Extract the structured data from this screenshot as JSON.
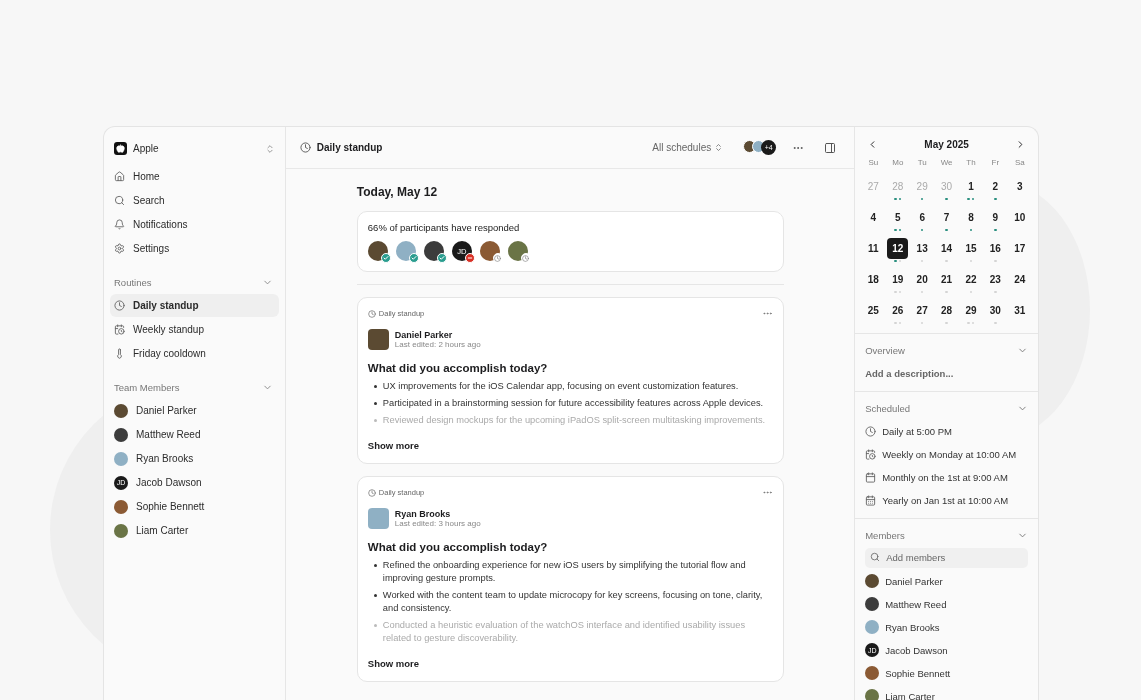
{
  "sidebar": {
    "workspace": "Apple",
    "nav": [
      {
        "label": "Home"
      },
      {
        "label": "Search"
      },
      {
        "label": "Notifications"
      },
      {
        "label": "Settings"
      }
    ],
    "routines": {
      "title": "Routines",
      "expanded": true,
      "items": [
        {
          "label": "Daily standup",
          "selected": true
        },
        {
          "label": "Weekly standup",
          "selected": false
        },
        {
          "label": "Friday cooldown",
          "selected": false
        }
      ]
    },
    "team": {
      "title": "Team Members",
      "expanded": true,
      "members": [
        {
          "name": "Daniel Parker",
          "kind": "photo"
        },
        {
          "name": "Matthew Reed",
          "kind": "photo"
        },
        {
          "name": "Ryan Brooks",
          "kind": "photo"
        },
        {
          "name": "Jacob Dawson",
          "kind": "initials",
          "initials": "JD"
        },
        {
          "name": "Sophie Bennett",
          "kind": "photo"
        },
        {
          "name": "Liam Carter",
          "kind": "photo"
        }
      ]
    }
  },
  "header": {
    "title": "Daily standup",
    "filter": "All schedules",
    "extra_count": "+4"
  },
  "feed": {
    "date": "Today, May 12",
    "responses": {
      "title": "66% of participants have responded",
      "participants": [
        {
          "kind": "photo",
          "responded": true,
          "declined": false
        },
        {
          "kind": "photo",
          "responded": true,
          "declined": false
        },
        {
          "kind": "photo",
          "responded": true,
          "declined": false
        },
        {
          "kind": "initials",
          "initials": "JD",
          "responded": false,
          "declined": true
        },
        {
          "kind": "photo",
          "responded": false,
          "declined": false
        },
        {
          "kind": "photo",
          "responded": false,
          "declined": false
        }
      ]
    },
    "entries": [
      {
        "tag": "Daily standup",
        "author": "Daniel Parker",
        "edited": "Last edited: 2 hours ago",
        "question": "What did you accomplish today?",
        "more": "Show more",
        "bullets": [
          {
            "text": "UX improvements for the iOS Calendar app, focusing on event customization features.",
            "faded": false
          },
          {
            "text": "Participated in a brainstorming session for future accessibility features across Apple devices.",
            "faded": false
          },
          {
            "text": "Reviewed design mockups for the upcoming iPadOS split-screen multitasking improvements.",
            "faded": true
          }
        ]
      },
      {
        "tag": "Daily standup",
        "author": "Ryan Brooks",
        "edited": "Last edited: 3 hours ago",
        "question": "What did you accomplish today?",
        "more": "Show more",
        "bullets": [
          {
            "text": "Refined the onboarding experience for new iOS users by simplifying the tutorial flow and improving gesture prompts.",
            "faded": false
          },
          {
            "text": "Worked with the content team to update microcopy for key screens, focusing on tone, clarity, and consistency.",
            "faded": false
          },
          {
            "text": "Conducted a heuristic evaluation of the watchOS interface and identified usability issues related to gesture discoverability.",
            "faded": true
          }
        ]
      }
    ]
  },
  "calendar": {
    "month": "May 2025",
    "weekdays": [
      "Su",
      "Mo",
      "Tu",
      "We",
      "Th",
      "Fr",
      "Sa"
    ],
    "weeks": [
      [
        {
          "label": "27",
          "muted": true,
          "selected": false
        },
        {
          "label": "28",
          "muted": true,
          "selected": false,
          "events": [
            {
              "done": true
            },
            {
              "done": true
            }
          ]
        },
        {
          "label": "29",
          "muted": true,
          "selected": false,
          "events": [
            {
              "done": true
            }
          ]
        },
        {
          "label": "30",
          "muted": true,
          "selected": false,
          "events": [
            {
              "done": true
            }
          ]
        },
        {
          "label": "1",
          "muted": false,
          "selected": false,
          "events": [
            {
              "done": true
            },
            {
              "done": true
            }
          ]
        },
        {
          "label": "2",
          "muted": false,
          "selected": false,
          "events": [
            {
              "done": true
            }
          ]
        },
        {
          "label": "3",
          "muted": false,
          "selected": false
        }
      ],
      [
        {
          "label": "4",
          "muted": false,
          "selected": false
        },
        {
          "label": "5",
          "muted": false,
          "selected": false,
          "events": [
            {
              "done": true
            },
            {
              "done": true
            }
          ]
        },
        {
          "label": "6",
          "muted": false,
          "selected": false,
          "events": [
            {
              "done": true
            }
          ]
        },
        {
          "label": "7",
          "muted": false,
          "selected": false,
          "events": [
            {
              "done": true
            }
          ]
        },
        {
          "label": "8",
          "muted": false,
          "selected": false,
          "events": [
            {
              "done": true
            }
          ]
        },
        {
          "label": "9",
          "muted": false,
          "selected": false,
          "events": [
            {
              "done": true
            }
          ]
        },
        {
          "label": "10",
          "muted": false,
          "selected": false
        }
      ],
      [
        {
          "label": "11",
          "muted": false,
          "selected": false
        },
        {
          "label": "12",
          "muted": false,
          "selected": true,
          "events": [
            {
              "done": true
            },
            {
              "done": false
            }
          ]
        },
        {
          "label": "13",
          "muted": false,
          "selected": false,
          "events": [
            {
              "done": false
            }
          ]
        },
        {
          "label": "14",
          "muted": false,
          "selected": false,
          "events": [
            {
              "done": false
            }
          ]
        },
        {
          "label": "15",
          "muted": false,
          "selected": false,
          "events": [
            {
              "done": false
            }
          ]
        },
        {
          "label": "16",
          "muted": false,
          "selected": false,
          "events": [
            {
              "done": false
            }
          ]
        },
        {
          "label": "17",
          "muted": false,
          "selected": false
        }
      ],
      [
        {
          "label": "18",
          "muted": false,
          "selected": false
        },
        {
          "label": "19",
          "muted": false,
          "selected": false,
          "events": [
            {
              "done": false
            },
            {
              "done": false
            }
          ]
        },
        {
          "label": "20",
          "muted": false,
          "selected": false,
          "events": [
            {
              "done": false
            }
          ]
        },
        {
          "label": "21",
          "muted": false,
          "selected": false,
          "events": [
            {
              "done": false
            }
          ]
        },
        {
          "label": "22",
          "muted": false,
          "selected": false,
          "events": [
            {
              "done": false
            }
          ]
        },
        {
          "label": "23",
          "muted": false,
          "selected": false,
          "events": [
            {
              "done": false
            }
          ]
        },
        {
          "label": "24",
          "muted": false,
          "selected": false
        }
      ],
      [
        {
          "label": "25",
          "muted": false,
          "selected": false
        },
        {
          "label": "26",
          "muted": false,
          "selected": false,
          "events": [
            {
              "done": false
            },
            {
              "done": false
            }
          ]
        },
        {
          "label": "27",
          "muted": false,
          "selected": false,
          "events": [
            {
              "done": false
            }
          ]
        },
        {
          "label": "28",
          "muted": false,
          "selected": false,
          "events": [
            {
              "done": false
            }
          ]
        },
        {
          "label": "29",
          "muted": false,
          "selected": false,
          "events": [
            {
              "done": false
            },
            {
              "done": false
            }
          ]
        },
        {
          "label": "30",
          "muted": false,
          "selected": false,
          "events": [
            {
              "done": false
            }
          ]
        },
        {
          "label": "31",
          "muted": false,
          "selected": false
        }
      ]
    ]
  },
  "details": {
    "overview": {
      "title": "Overview",
      "expanded": true,
      "placeholder": "Add a description..."
    },
    "scheduled": {
      "title": "Scheduled",
      "expanded": true,
      "items": [
        "Daily at 5:00 PM",
        "Weekly on Monday at 10:00 AM",
        "Monthly on the 1st at 9:00 AM",
        "Yearly on Jan 1st at 10:00 AM"
      ]
    },
    "members": {
      "title": "Members",
      "expanded": true,
      "placeholder": "Add members",
      "members": [
        {
          "name": "Daniel Parker",
          "kind": "photo"
        },
        {
          "name": "Matthew Reed",
          "kind": "photo"
        },
        {
          "name": "Ryan Brooks",
          "kind": "photo"
        },
        {
          "name": "Jacob Dawson",
          "kind": "initials",
          "initials": "JD"
        },
        {
          "name": "Sophie Bennett",
          "kind": "photo"
        },
        {
          "name": "Liam Carter",
          "kind": "photo"
        }
      ]
    }
  }
}
